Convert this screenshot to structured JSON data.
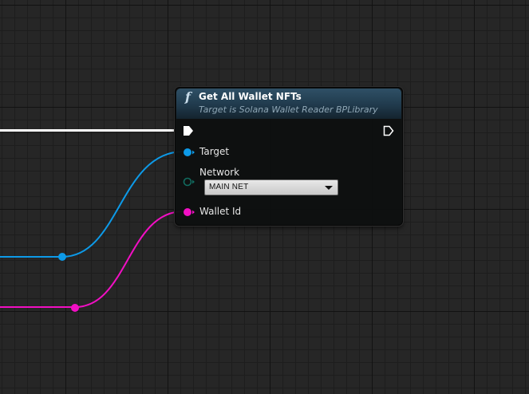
{
  "node": {
    "title": "Get All Wallet NFTs",
    "subtitle": "Target is Solana Wallet Reader BPLibrary",
    "icon": "function-icon",
    "header_color": "#2f5066",
    "pins": {
      "target_label": "Target",
      "network_label": "Network",
      "wallet_id_label": "Wallet Id"
    },
    "network_dropdown": {
      "selected": "MAIN NET"
    }
  },
  "colors": {
    "exec_wire": "#ffffff",
    "object_pin": "#0d9ae8",
    "string_pin": "#f20fc4",
    "enum_pin": "#116b5f"
  }
}
